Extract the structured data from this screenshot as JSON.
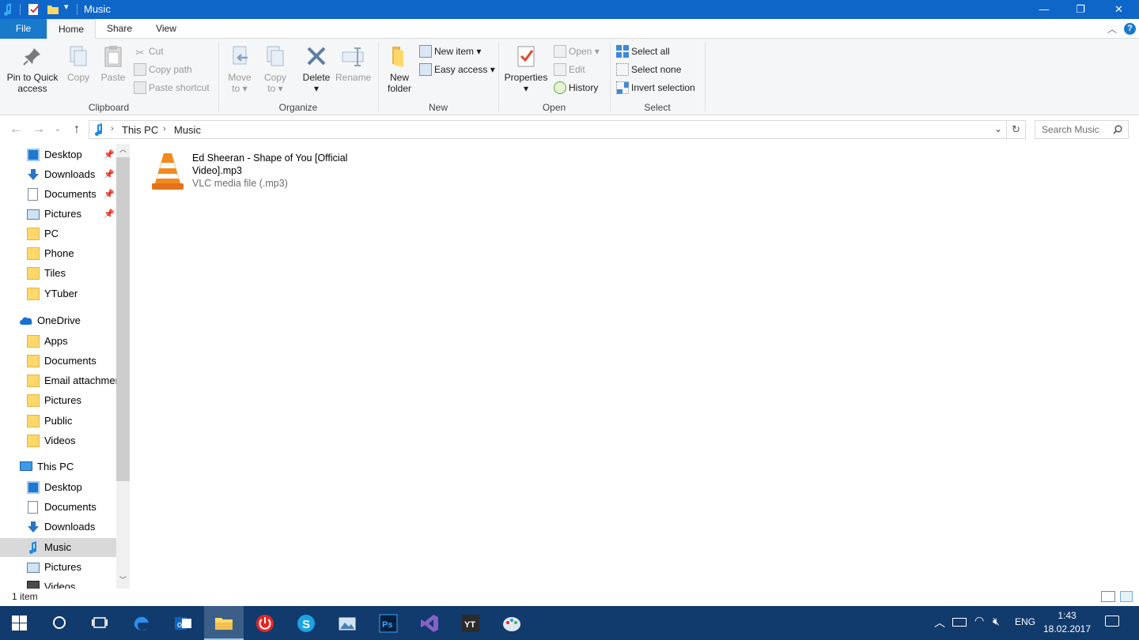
{
  "window": {
    "title": "Music",
    "icons": [
      "music-note-icon",
      "properties-icon",
      "new-folder-icon",
      "customize-dropdown-icon"
    ],
    "controls": {
      "minimize": "—",
      "maximize": "❐",
      "close": "✕"
    }
  },
  "tabs": {
    "file": "File",
    "home": "Home",
    "share": "Share",
    "view": "View",
    "help": "?"
  },
  "ribbon": {
    "clipboard": {
      "label": "Clipboard",
      "pin": "Pin to Quick access",
      "pin_line1": "Pin to Quick",
      "pin_line2": "access",
      "copy": "Copy",
      "paste": "Paste",
      "cut": "Cut",
      "copy_path": "Copy path",
      "paste_shortcut": "Paste shortcut"
    },
    "organize": {
      "label": "Organize",
      "move_to_1": "Move",
      "move_to_2": "to",
      "copy_to_1": "Copy",
      "copy_to_2": "to",
      "delete": "Delete",
      "rename": "Rename"
    },
    "new": {
      "label": "New",
      "new_folder_1": "New",
      "new_folder_2": "folder",
      "new_item": "New item",
      "easy_access": "Easy access"
    },
    "open": {
      "label": "Open",
      "properties": "Properties",
      "open": "Open",
      "edit": "Edit",
      "history": "History"
    },
    "select": {
      "label": "Select",
      "select_all": "Select all",
      "select_none": "Select none",
      "invert_selection": "Invert selection"
    }
  },
  "address": {
    "crumbs": [
      "This PC",
      "Music"
    ],
    "search_placeholder": "Search Music"
  },
  "nav": {
    "quick": [
      {
        "label": "Desktop",
        "pinned": true
      },
      {
        "label": "Downloads",
        "pinned": true
      },
      {
        "label": "Documents",
        "pinned": true
      },
      {
        "label": "Pictures",
        "pinned": true
      },
      {
        "label": "PC"
      },
      {
        "label": "Phone"
      },
      {
        "label": "Tiles"
      },
      {
        "label": "YTuber"
      }
    ],
    "onedrive": {
      "label": "OneDrive",
      "children": [
        "Apps",
        "Documents",
        "Email attachmer",
        "Pictures",
        "Public",
        "Videos"
      ]
    },
    "thispc": {
      "label": "This PC",
      "children": [
        "Desktop",
        "Documents",
        "Downloads",
        "Music",
        "Pictures",
        "Videos"
      ]
    }
  },
  "files": [
    {
      "name_line1": "Ed Sheeran - Shape of You [Official",
      "name_line2": "Video].mp3",
      "type": "VLC media file (.mp3)"
    }
  ],
  "status": {
    "count": "1 item"
  },
  "taskbar": {
    "apps": [
      "start",
      "cortana",
      "task-view",
      "edge",
      "outlook",
      "file-explorer",
      "power",
      "skype",
      "photos",
      "photoshop",
      "visual-studio",
      "yt",
      "paint"
    ],
    "tray": {
      "language": "ENG",
      "time": "1:43",
      "date": "18.02.2017"
    }
  },
  "colors": {
    "titlebar": "#0f66c9",
    "file_tab": "#1979ca",
    "ribbon_bg": "#f5f6f7",
    "taskbar": "#113a6d",
    "selected_nav": "#d9d9d9"
  }
}
